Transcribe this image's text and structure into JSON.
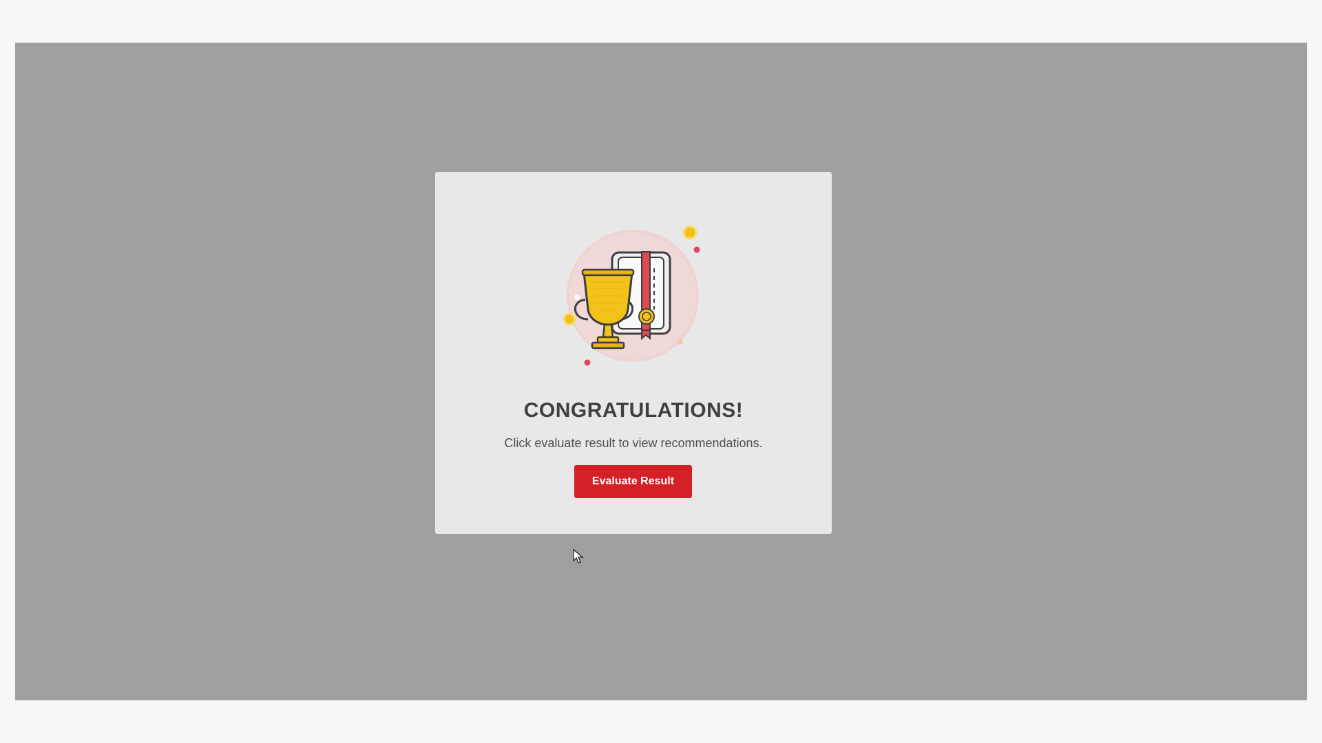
{
  "modal": {
    "title": "CONGRATULATIONS!",
    "message": "Click evaluate result to view recommendations.",
    "button_label": "Evaluate Result",
    "illustration_icon": "trophy-certificate-icon"
  },
  "colors": {
    "backdrop": "#9f9f9f",
    "modal_bg": "#e8e8e8",
    "accent_red": "#d42027",
    "gold": "#f2c21b",
    "circle_pink": "#f3d3d3"
  }
}
